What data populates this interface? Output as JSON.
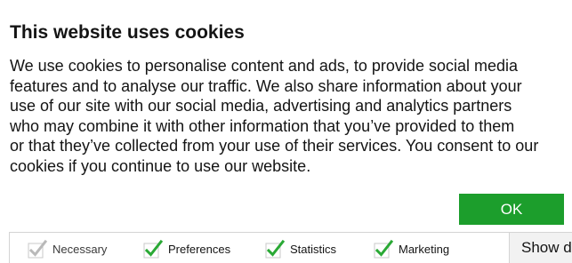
{
  "banner": {
    "title": "This website uses cookies",
    "body_lines": [
      "We use cookies to personalise content and ads, to provide social media",
      "features and to analyse our traffic. We also share information about your",
      "use of our site with our social media, advertising and analytics partners",
      "who may combine it with other information that you’ve provided to them",
      "or that they’ve collected from your use of their services. You consent to our",
      "cookies if you continue to use our website."
    ],
    "ok_label": "OK",
    "show_details_label": "Show details"
  },
  "preferences": [
    {
      "label": "Necessary",
      "checked": true,
      "disabled": true
    },
    {
      "label": "Preferences",
      "checked": true,
      "disabled": false
    },
    {
      "label": "Statistics",
      "checked": true,
      "disabled": false
    },
    {
      "label": "Marketing",
      "checked": true,
      "disabled": false
    }
  ],
  "colors": {
    "accent_green": "#1c9e2c",
    "check_green": "#2aa935",
    "check_disabled": "#b9b9b9",
    "text": "#141414",
    "border": "#d4d4d4"
  }
}
